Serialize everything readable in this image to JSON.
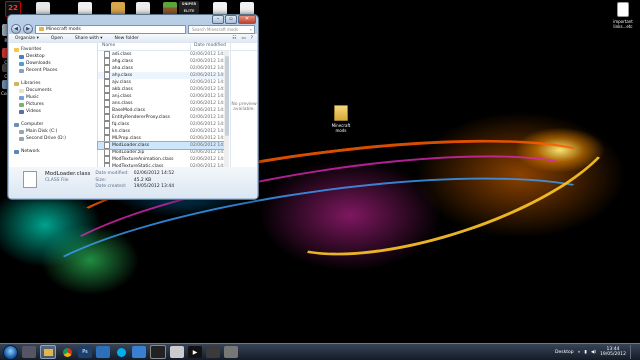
{
  "desktop": {
    "top_left_badge": "22",
    "left_icons": [
      "Re",
      "Co",
      "Ca",
      "Comp"
    ],
    "top_icons": [
      "",
      "",
      "",
      "",
      "",
      "",
      "",
      "",
      "",
      ""
    ],
    "sniper_label": "SNIPER ELITE",
    "right_icon_label": "important links...etc",
    "folder_label": "Minecraft mods"
  },
  "window": {
    "address": "Minecraft mods",
    "search_placeholder": "Search Minecraft mods",
    "toolbar": {
      "organize": "Organize ▾",
      "open": "Open",
      "share": "Share with ▾",
      "new_folder": "New folder"
    },
    "nav": {
      "favorites": {
        "label": "Favorites",
        "items": [
          "Desktop",
          "Downloads",
          "Recent Places"
        ]
      },
      "libraries": {
        "label": "Libraries",
        "items": [
          "Documents",
          "Music",
          "Pictures",
          "Videos"
        ]
      },
      "computer": {
        "label": "Computer",
        "items": [
          "Main Disk (C:)",
          "Second Drive (D:)"
        ]
      },
      "network": {
        "label": "Network"
      }
    },
    "columns": {
      "name": "Name",
      "date": "Date modified"
    },
    "files": [
      {
        "name": "adi.class",
        "date": "02/06/2012 14:4"
      },
      {
        "name": "ahg.class",
        "date": "02/06/2012 14:4"
      },
      {
        "name": "aha.class",
        "date": "02/06/2012 14:4"
      },
      {
        "name": "ahy.class",
        "date": "02/06/2012 14:4"
      },
      {
        "name": "ajv.class",
        "date": "02/06/2012 14:4"
      },
      {
        "name": "akb.class",
        "date": "02/06/2012 14:4"
      },
      {
        "name": "anj.class",
        "date": "02/06/2012 14:4"
      },
      {
        "name": "ans.class",
        "date": "02/06/2012 14:4"
      },
      {
        "name": "BaseMod.class",
        "date": "02/06/2012 14:4"
      },
      {
        "name": "EntityRendererProxy.class",
        "date": "02/06/2012 14:4"
      },
      {
        "name": "fq.class",
        "date": "02/06/2012 14:4"
      },
      {
        "name": "kn.class",
        "date": "02/06/2012 14:4"
      },
      {
        "name": "MLProp.class",
        "date": "02/06/2012 14:4"
      },
      {
        "name": "ModLoader.class",
        "date": "02/06/2012 14:4"
      },
      {
        "name": "ModLoader.zip",
        "date": "02/06/2012 14:4"
      },
      {
        "name": "ModTextureAnimation.class",
        "date": "02/06/2012 14:4"
      },
      {
        "name": "ModTextureStatic.class",
        "date": "02/06/2012 14:4"
      }
    ],
    "preview_text": "No preview available.",
    "details": {
      "name": "ModLoader.class",
      "type": "CLASS File",
      "modified_label": "Date modified:",
      "modified": "02/06/2012 14:52",
      "created_label": "Date created:",
      "created": "19/05/2012 13:44",
      "size_label": "Size:",
      "size": "45.2 KB"
    }
  },
  "taskbar": {
    "desktop_label": "Desktop",
    "time": "13:44",
    "date": "19/05/2012"
  },
  "colors": {
    "window_frame": "#a9c2dd",
    "selection": "#cde6fb",
    "taskbar": "#1c2838"
  }
}
